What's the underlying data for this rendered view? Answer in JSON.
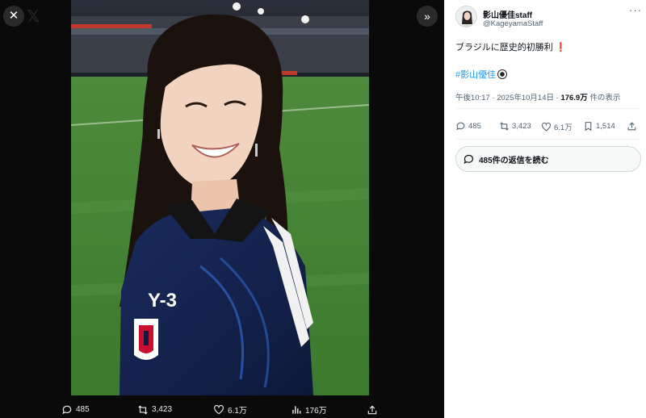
{
  "viewer": {
    "close_icon_glyph": "✕",
    "brand_glyph": "𝕏",
    "expand_icon_glyph": "»",
    "photo_jersey_text": "Y-3",
    "actions": {
      "replies": "485",
      "retweets": "3,423",
      "likes": "6.1万",
      "views": "176万"
    }
  },
  "tweet": {
    "author_name": "影山優佳staff",
    "author_handle": "@KageyamaStaff",
    "more_glyph": "···",
    "text": "ブラジルに歴史的初勝利",
    "text_emoji": "❗",
    "hashtag": "#影山優佳",
    "meta_time": "午後10:17 · 2025年10月14日 · ",
    "meta_views": "176.9万",
    "meta_views_suffix": " 件の表示",
    "stats": {
      "replies": "485",
      "retweets": "3,423",
      "likes": "6.1万",
      "bookmarks": "1,514"
    },
    "read_replies_label": "485件の返信を読む"
  },
  "colors": {
    "accent": "#1d9bf0",
    "viewer_bg": "#0a0a0a",
    "text_primary": "#0f1419",
    "text_secondary": "#536471"
  },
  "icons": [
    "close-icon",
    "x-logo-icon",
    "expand-icon",
    "reply-icon",
    "retweet-icon",
    "like-icon",
    "views-icon",
    "share-icon",
    "bookmark-icon",
    "more-icon",
    "soccer-ball-icon"
  ]
}
